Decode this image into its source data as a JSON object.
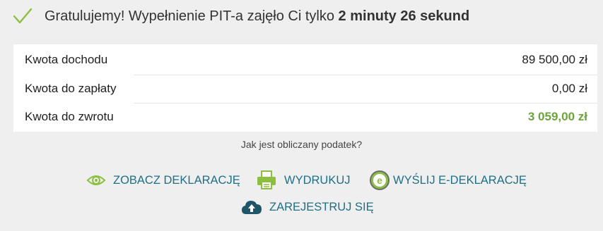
{
  "header": {
    "title_prefix": "Gratulujemy! Wypełnienie PIT-a zajęło Ci tylko",
    "title_bold": "2 minuty 26 sekund"
  },
  "summary": [
    {
      "label": "Kwota dochodu",
      "value": "89 500,00 zł"
    },
    {
      "label": "Kwota do zapłaty",
      "value": "0,00 zł"
    },
    {
      "label": "Kwota do zwrotu",
      "value": "3 059,00 zł"
    }
  ],
  "how_link": "Jak jest obliczany podatek?",
  "actions": {
    "view": "ZOBACZ DEKLARACJĘ",
    "print": "WYDRUKUJ",
    "send": "WYŚLIJ E-DEKLARACJĘ",
    "register": "ZAREJESTRUJ SIĘ"
  },
  "colors": {
    "accent_green": "#6aa43a",
    "action_teal": "#1f6f86",
    "background": "#efefef"
  },
  "icons": {
    "header": "check-icon",
    "view": "eye-icon",
    "print": "printer-icon",
    "send": "e-icon",
    "register": "cloud-upload-icon"
  }
}
